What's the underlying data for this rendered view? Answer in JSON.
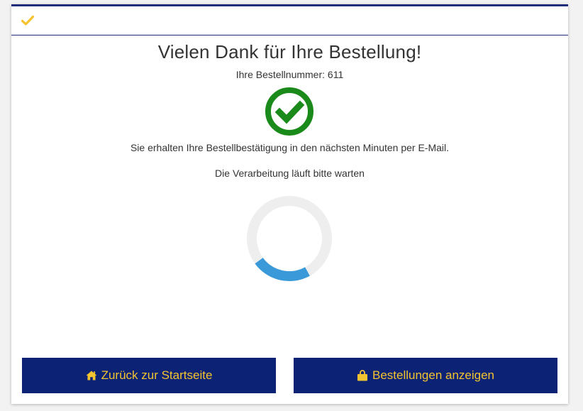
{
  "header": {
    "icon": "checkmark-icon",
    "icon_color": "#f4c430",
    "border_color": "#1f2f7a"
  },
  "main": {
    "title": "Vielen Dank für Ihre Bestellung!",
    "order_number": "Ihre Bestellnummer: 611",
    "success_icon": "check-circle-icon",
    "success_color": "#1a8a1a",
    "confirmation_text": "Sie erhalten Ihre Bestellbestätigung in den nächsten Minuten per E-Mail.",
    "processing_text": "Die Verarbeitung läuft bitte warten",
    "spinner": {
      "track_color": "#eeeeee",
      "arc_color": "#3a9ad9"
    }
  },
  "actions": {
    "home_label": "Zurück zur Startseite",
    "home_icon": "home-icon",
    "orders_label": "Bestellungen anzeigen",
    "orders_icon": "shopping-bag-icon",
    "button_bg": "#0c2375",
    "button_text_color": "#f4c430"
  }
}
